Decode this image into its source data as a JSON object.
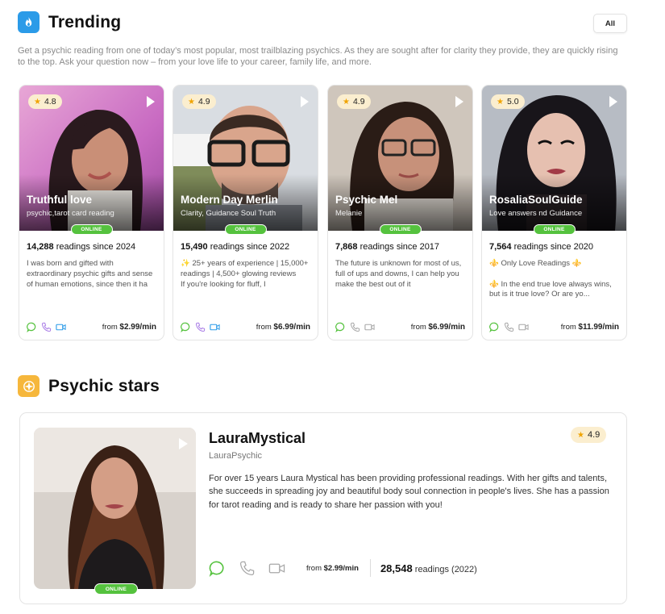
{
  "trending": {
    "title": "Trending",
    "icon": "fire-icon",
    "all_label": "All",
    "intro": "Get a psychic reading from one of today’s most popular, most trailblazing psychics. As they are sought after for clarity they provide, they are quickly rising to the top. Ask your question now – from your love life to your career, family life, and more.",
    "cards": [
      {
        "name": "Truthful love",
        "tagline": "psychic,tarot card reading",
        "rating": "4.8",
        "status": "ONLINE",
        "readings_count": "14,288",
        "readings_suffix": " readings since 2024",
        "description": "I was born and gifted with extraordinary psychic gifts and sense of human emotions, since then it ha",
        "price_prefix": "from ",
        "price": "$2.99/min",
        "chat_color": "#55c23e",
        "call_color": "#a97de6",
        "video_color": "#2b9be8"
      },
      {
        "name": "Modern Day Merlin",
        "tagline": "Clarity, Guidance Soul Truth",
        "rating": "4.9",
        "status": "ONLINE",
        "readings_count": "15,490",
        "readings_suffix": " readings since 2022",
        "description": "✨ 25+ years of experience | 15,000+ readings | 4,500+ glowing reviews\nIf you're looking for fluff, I",
        "price_prefix": "from ",
        "price": "$6.99/min",
        "chat_color": "#55c23e",
        "call_color": "#a97de6",
        "video_color": "#2b9be8"
      },
      {
        "name": "Psychic Mel",
        "tagline": "Melanie",
        "rating": "4.9",
        "status": "ONLINE",
        "readings_count": "7,868",
        "readings_suffix": " readings since 2017",
        "description": "The future is unknown for most of us, full of ups and downs, I can help you make the best out of it",
        "price_prefix": "from ",
        "price": "$6.99/min",
        "chat_color": "#55c23e",
        "call_color": "#a8a8a8",
        "video_color": "#a8a8a8"
      },
      {
        "name": "RosaliaSoulGuide",
        "tagline": "Love answers nd Guidance",
        "rating": "5.0",
        "status": "ONLINE",
        "readings_count": "7,564",
        "readings_suffix": " readings since 2020",
        "description": "⚜️ Only Love Readings ⚜️\n\n⚜️ In the end true love always wins, but is it true love? Or are yo...",
        "price_prefix": "from ",
        "price": "$11.99/min",
        "chat_color": "#55c23e",
        "call_color": "#a8a8a8",
        "video_color": "#a8a8a8"
      }
    ]
  },
  "stars": {
    "title": "Psychic stars",
    "icon": "compass-star-icon",
    "featured": {
      "name": "LauraMystical",
      "tagline": "LauraPsychic",
      "rating": "4.9",
      "status": "ONLINE",
      "description": "For over 15 years Laura Mystical has been providing professional readings. With her gifts and talents, she succeeds in spreading joy and beautiful body soul connection in people's lives. She has a passion for tarot reading and is ready to share her passion with you!",
      "price_prefix": "from ",
      "price": "$2.99/min",
      "readings_count": "28,548",
      "readings_suffix": " readings (2022)"
    }
  },
  "colors": {
    "online": "#55c23e",
    "rating_bg": "#fbeecf",
    "star": "#f0a400",
    "trending_icon_bg": "#2b9be8",
    "stars_icon_bg": "#f6b73c"
  }
}
